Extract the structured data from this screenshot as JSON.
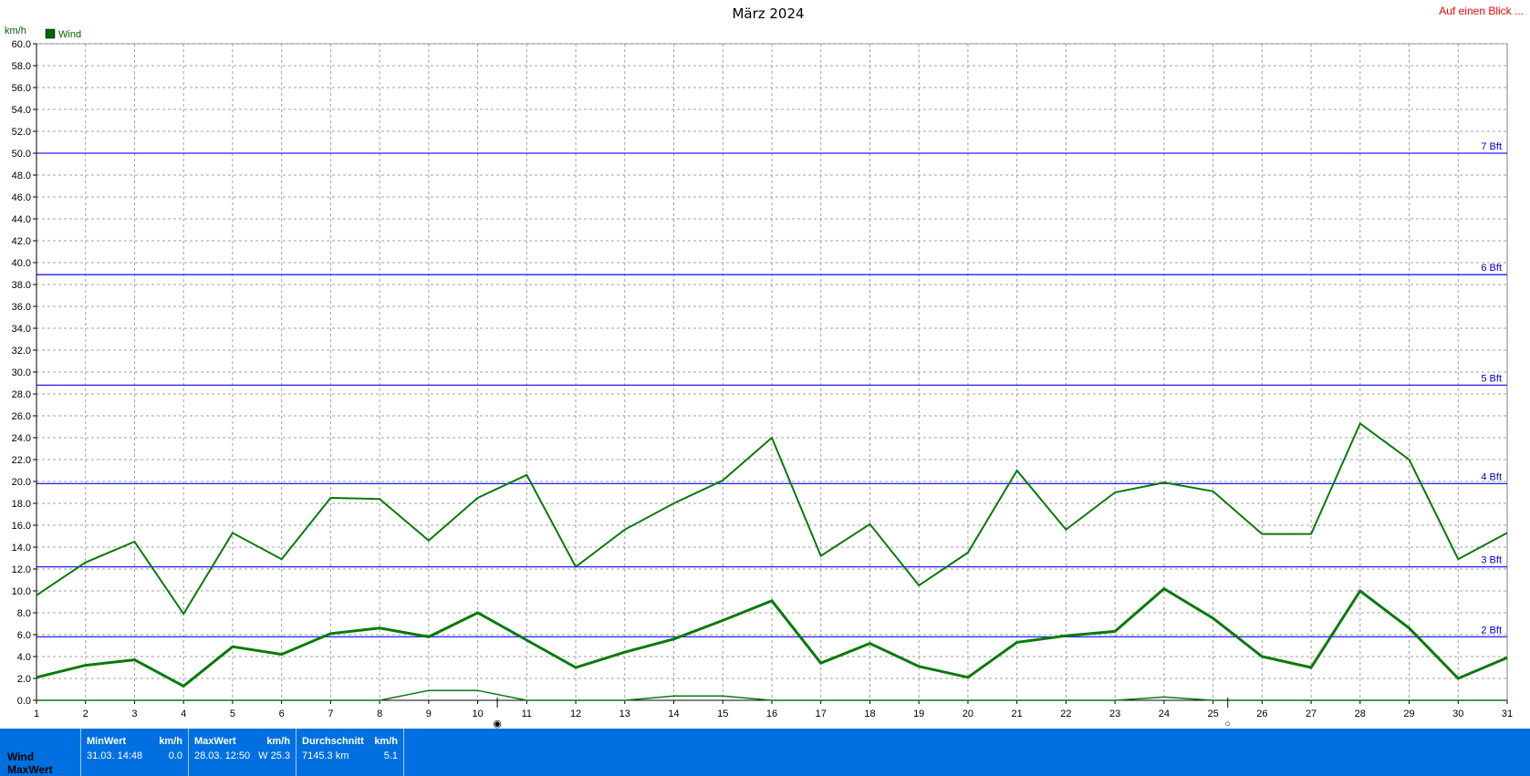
{
  "header": {
    "title": "März 2024",
    "link": "Auf einen Blick ...",
    "unit": "km/h"
  },
  "legend": {
    "label": "Wind",
    "color": "#006400"
  },
  "bft_lines": [
    {
      "label": "2 Bft",
      "value": 5.8
    },
    {
      "label": "3 Bft",
      "value": 12.2
    },
    {
      "label": "4 Bft",
      "value": 19.8
    },
    {
      "label": "5 Bft",
      "value": 28.8
    },
    {
      "label": "6 Bft",
      "value": 38.9
    },
    {
      "label": "7 Bft",
      "value": 50.0
    }
  ],
  "chart_data": {
    "type": "line",
    "title": "März 2024",
    "ylabel": "km/h",
    "xlabel": "",
    "x": [
      1,
      2,
      3,
      4,
      5,
      6,
      7,
      8,
      9,
      10,
      11,
      12,
      13,
      14,
      15,
      16,
      17,
      18,
      19,
      20,
      21,
      22,
      23,
      24,
      25,
      26,
      27,
      28,
      29,
      30,
      31
    ],
    "ylim": [
      0,
      60
    ],
    "yticks": [
      "0.0",
      "2.0",
      "4.0",
      "6.0",
      "8.0",
      "10.0",
      "12.0",
      "14.0",
      "16.0",
      "18.0",
      "20.0",
      "22.0",
      "24.0",
      "26.0",
      "28.0",
      "30.0",
      "32.0",
      "34.0",
      "36.0",
      "38.0",
      "40.0",
      "42.0",
      "44.0",
      "46.0",
      "48.0",
      "50.0",
      "52.0",
      "54.0",
      "56.0",
      "58.0",
      "60.0"
    ],
    "grid": true,
    "legend_position": "top-left",
    "series": [
      {
        "name": "Wind",
        "role": "max",
        "values": [
          9.6,
          12.6,
          14.5,
          7.9,
          15.3,
          12.9,
          18.5,
          18.4,
          14.6,
          18.5,
          20.6,
          12.2,
          15.6,
          18.0,
          20.1,
          24.0,
          13.2,
          16.1,
          10.5,
          13.5,
          21.0,
          15.6,
          19.0,
          19.9,
          19.1,
          15.2,
          15.2,
          25.3,
          22.0,
          12.9,
          15.3
        ]
      },
      {
        "name": "Wind",
        "role": "avg",
        "values": [
          2.1,
          3.2,
          3.7,
          1.3,
          4.9,
          4.2,
          6.1,
          6.6,
          5.8,
          8.0,
          5.5,
          3.0,
          4.4,
          5.6,
          7.3,
          9.1,
          3.4,
          5.2,
          3.1,
          2.1,
          5.3,
          5.9,
          6.3,
          10.2,
          7.5,
          4.0,
          3.0,
          10.0,
          6.6,
          2.0,
          3.9
        ]
      },
      {
        "name": "Wind",
        "role": "min",
        "values": [
          0,
          0,
          0,
          0,
          0,
          0,
          0,
          0,
          0.9,
          0.9,
          0,
          0,
          0,
          0.4,
          0.4,
          0,
          0,
          0,
          0,
          0,
          0,
          0,
          0,
          0.3,
          0,
          0,
          0,
          0,
          0,
          0,
          0
        ]
      }
    ],
    "markers": [
      {
        "symbol": "◉",
        "x": 10.4
      },
      {
        "symbol": "○",
        "x": 25.3
      }
    ]
  },
  "footer": {
    "row1": "Wind",
    "row2": "MaxWert",
    "min": {
      "head": "MinWert",
      "unit": "km/h",
      "when": "31.03.  14:48",
      "val": "0.0"
    },
    "max": {
      "head": "MaxWert",
      "unit": "km/h",
      "when": "28.03.  12:50",
      "val": "W 25.3"
    },
    "avg": {
      "head": "Durchschnitt",
      "unit": "km/h",
      "when": "7145.3 km",
      "val": "5.1"
    }
  }
}
